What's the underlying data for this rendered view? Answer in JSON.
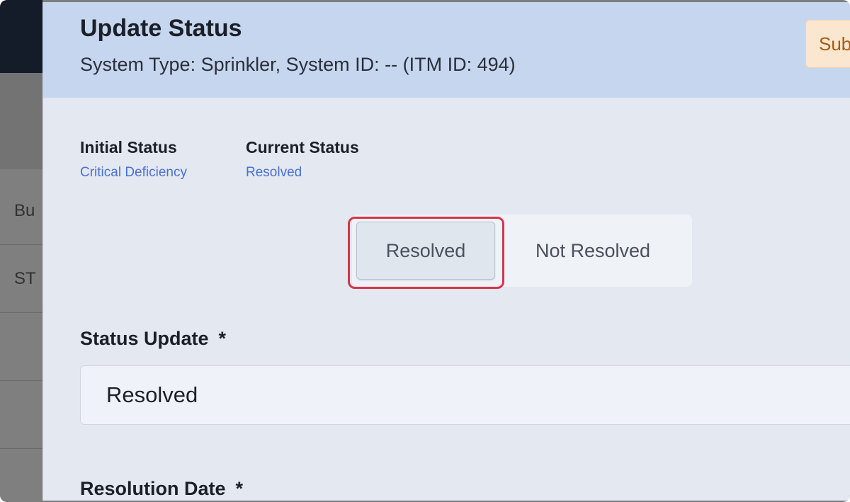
{
  "background": {
    "rows": [
      "Bu",
      "ST"
    ]
  },
  "modal": {
    "title": "Update Status",
    "subtitle": "System Type: Sprinkler, System ID: -- (ITM ID: 494)",
    "submit_label": "Sub"
  },
  "status": {
    "initial_label": "Initial Status",
    "initial_value": "Critical Deficiency",
    "current_label": "Current Status",
    "current_value": "Resolved"
  },
  "toggle": {
    "options": [
      "Resolved",
      "Not Resolved"
    ],
    "selected": "Resolved"
  },
  "fields": {
    "status_update_label": "Status Update",
    "status_update_required": "*",
    "status_update_value": "Resolved",
    "resolution_date_label": "Resolution Date",
    "resolution_date_required": "*"
  },
  "colors": {
    "highlight": "#d8344a",
    "link_blue": "#4a6fd6",
    "header_bg": "#c6d6ee"
  }
}
